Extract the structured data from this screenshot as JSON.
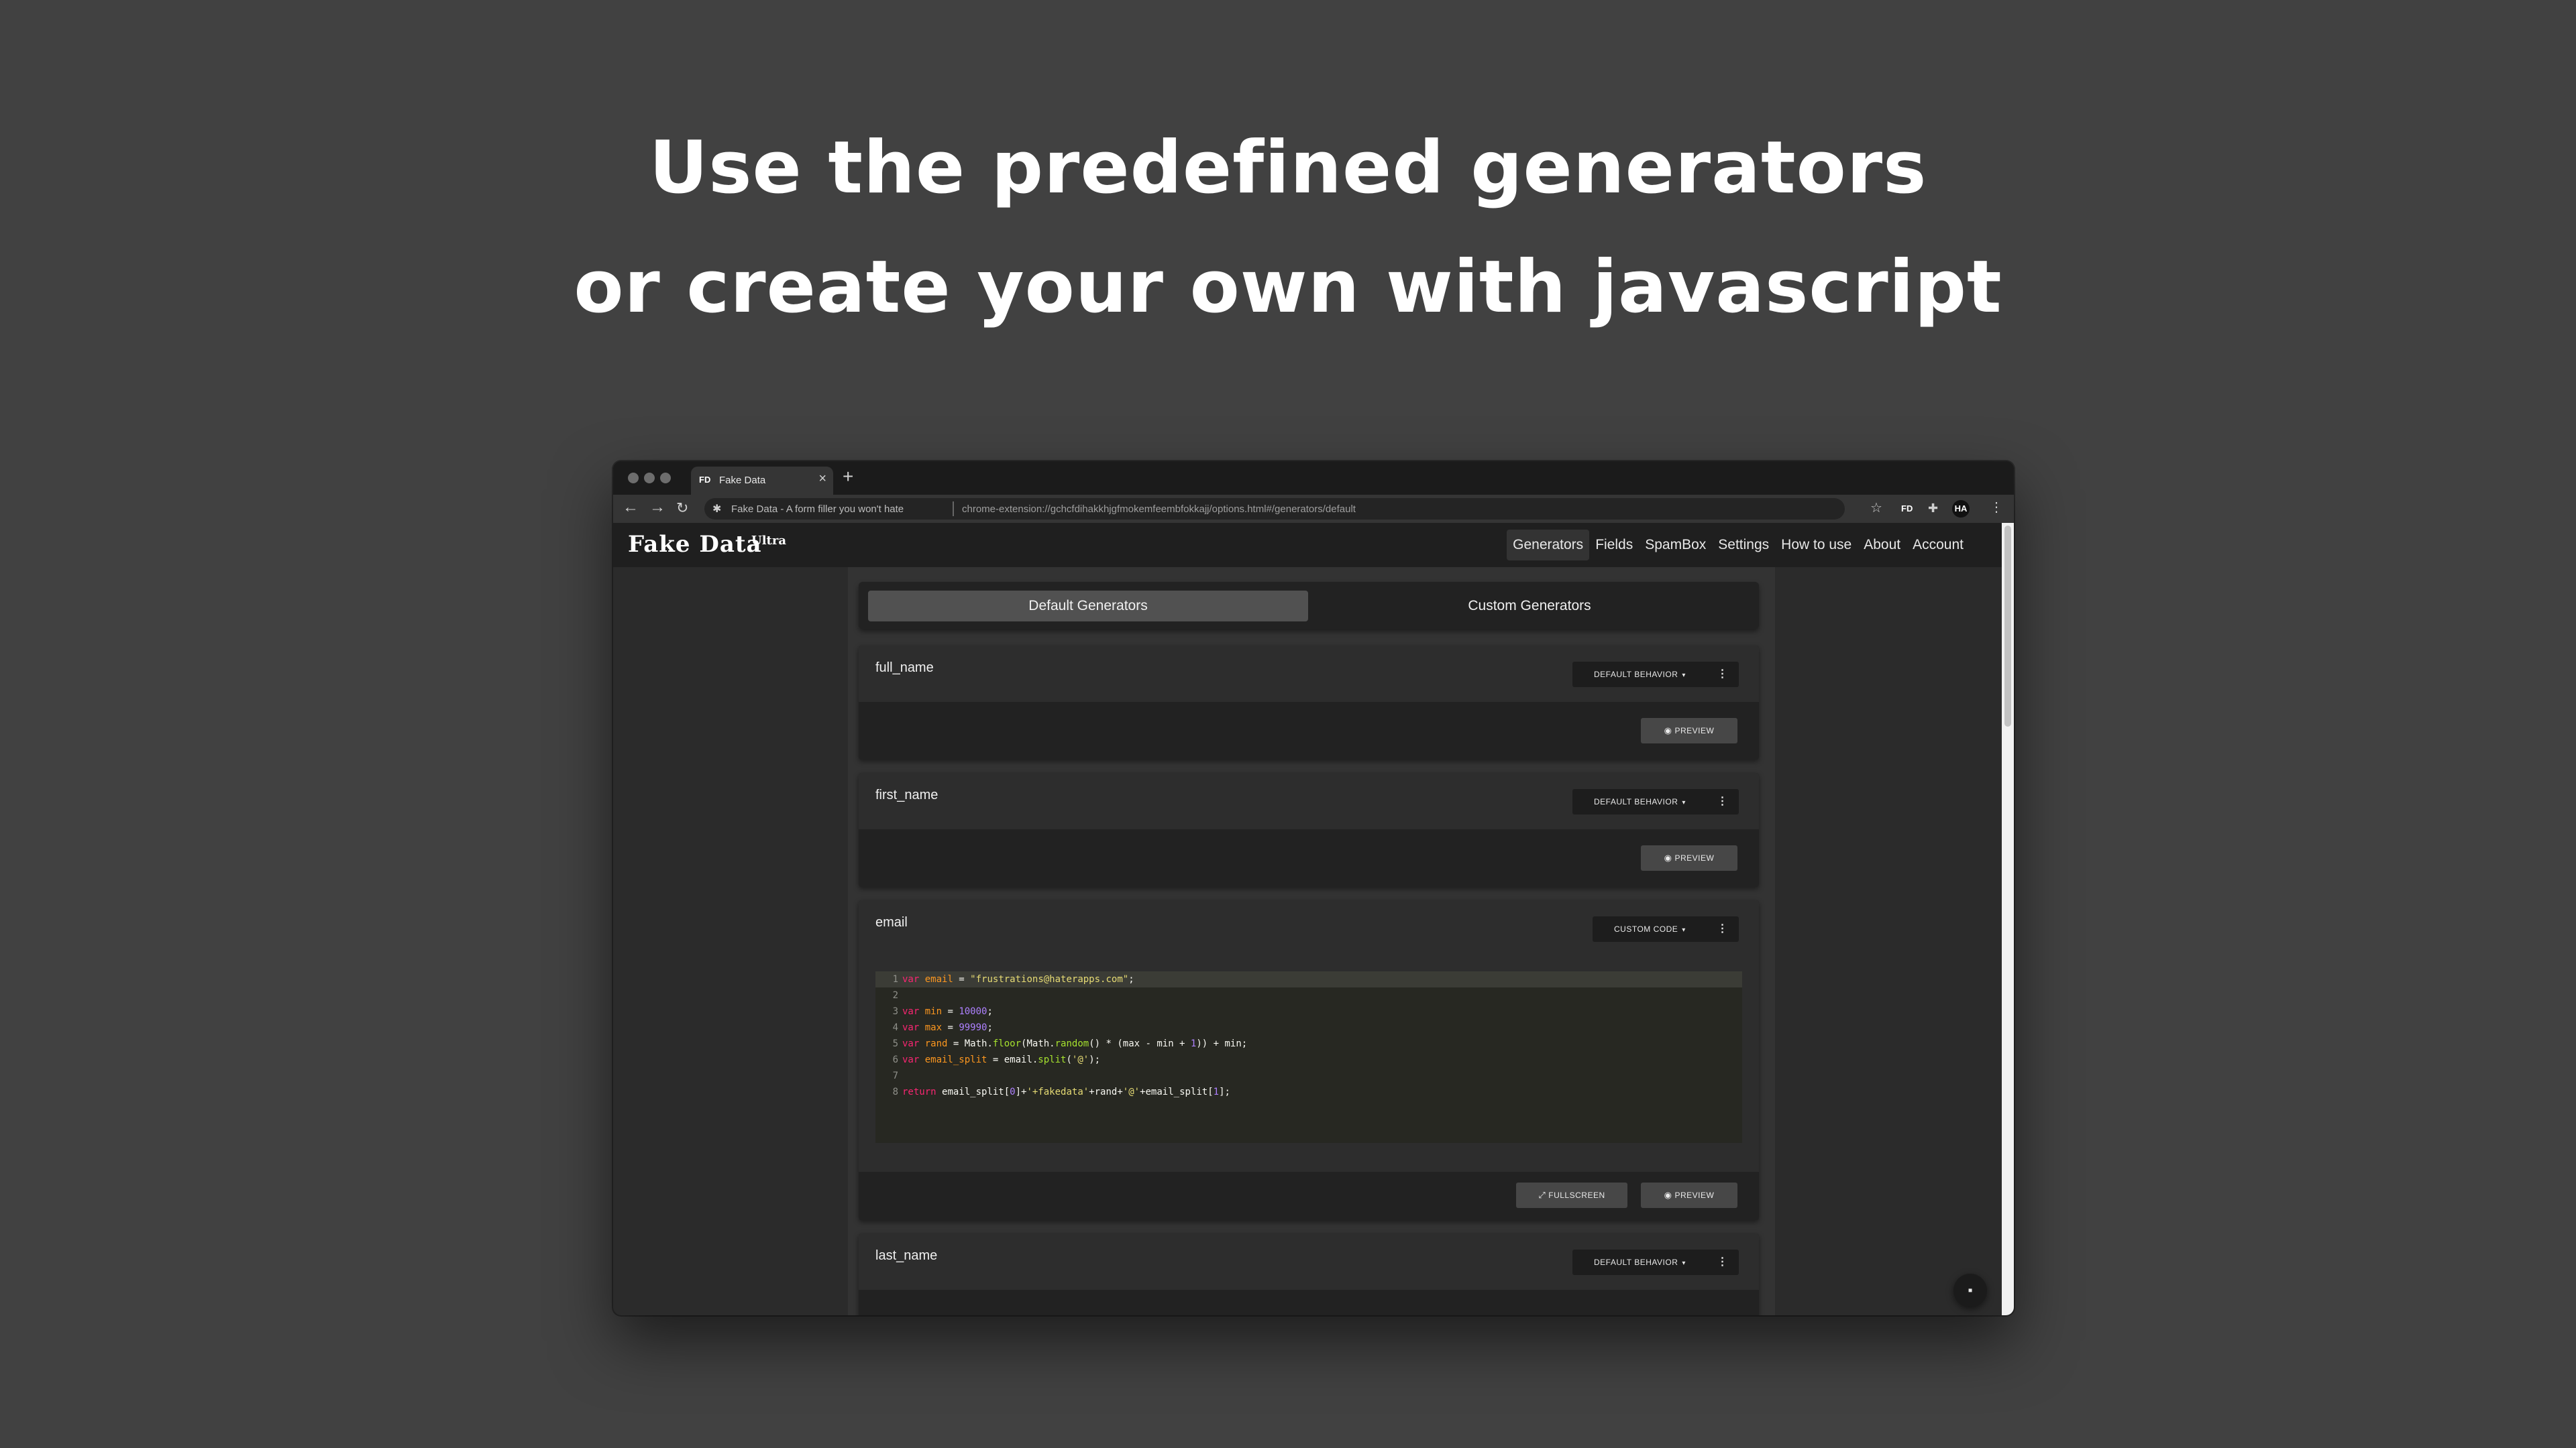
{
  "hero": {
    "line1": "Use the predefined generators",
    "line2": "or create your own with javascript"
  },
  "browser": {
    "tab_favicon": "FD",
    "tab_title": "Fake Data",
    "tab_close": "×",
    "new_tab": "+",
    "back": "←",
    "forward": "→",
    "reload": "↻",
    "site_icon": "✱",
    "site_label": "Fake Data - A form filler you won't hate",
    "url": "chrome-extension://gchcfdihakkhjgfmokemfeembfokkajj/options.html#/generators/default",
    "star": "☆",
    "ext_fd": "FD",
    "ext_puzzle": "✚",
    "avatar": "HA",
    "menu": "⋮"
  },
  "app": {
    "logo": "Fake Data",
    "logo_suffix": "Ultra",
    "nav": [
      "Generators",
      "Fields",
      "SpamBox",
      "Settings",
      "How to use",
      "About",
      "Account"
    ],
    "active_nav": "Generators"
  },
  "tabs": {
    "default": "Default Generators",
    "custom": "Custom Generators"
  },
  "generators": [
    {
      "name": "full_name",
      "behavior": "DEFAULT BEHAVIOR",
      "preview": "PREVIEW"
    },
    {
      "name": "first_name",
      "behavior": "DEFAULT BEHAVIOR",
      "preview": "PREVIEW"
    },
    {
      "name": "email",
      "behavior": "CUSTOM CODE",
      "preview": "PREVIEW",
      "fullscreen": "FULLSCREEN",
      "code": [
        "var email = \"frustrations@haterapps.com\";",
        "",
        "var min = 10000;",
        "var max = 99990;",
        "var rand = Math.floor(Math.random() * (max - min + 1)) + min;",
        "var email_split = email.split('@');",
        "",
        "return email_split[0]+'+fakedata'+rand+'@'+email_split[1];"
      ]
    },
    {
      "name": "last_name",
      "behavior": "DEFAULT BEHAVIOR"
    }
  ],
  "icons": {
    "caret": "▾",
    "more": "⋮",
    "eye": "◉",
    "expand": "⤢",
    "chat": "▪"
  }
}
